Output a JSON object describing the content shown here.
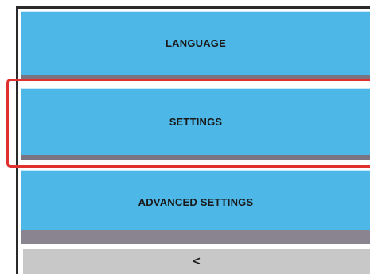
{
  "menu": {
    "items": [
      {
        "label": "LANGUAGE"
      },
      {
        "label": "SETTINGS",
        "selected": true
      },
      {
        "label": "ADVANCED SETTINGS"
      }
    ],
    "back_label": "<"
  },
  "colors": {
    "button_bg": "#4db8e8",
    "selection_outline": "#e03030",
    "back_bg": "#c8c8c8",
    "shadow": "#7a7480"
  }
}
